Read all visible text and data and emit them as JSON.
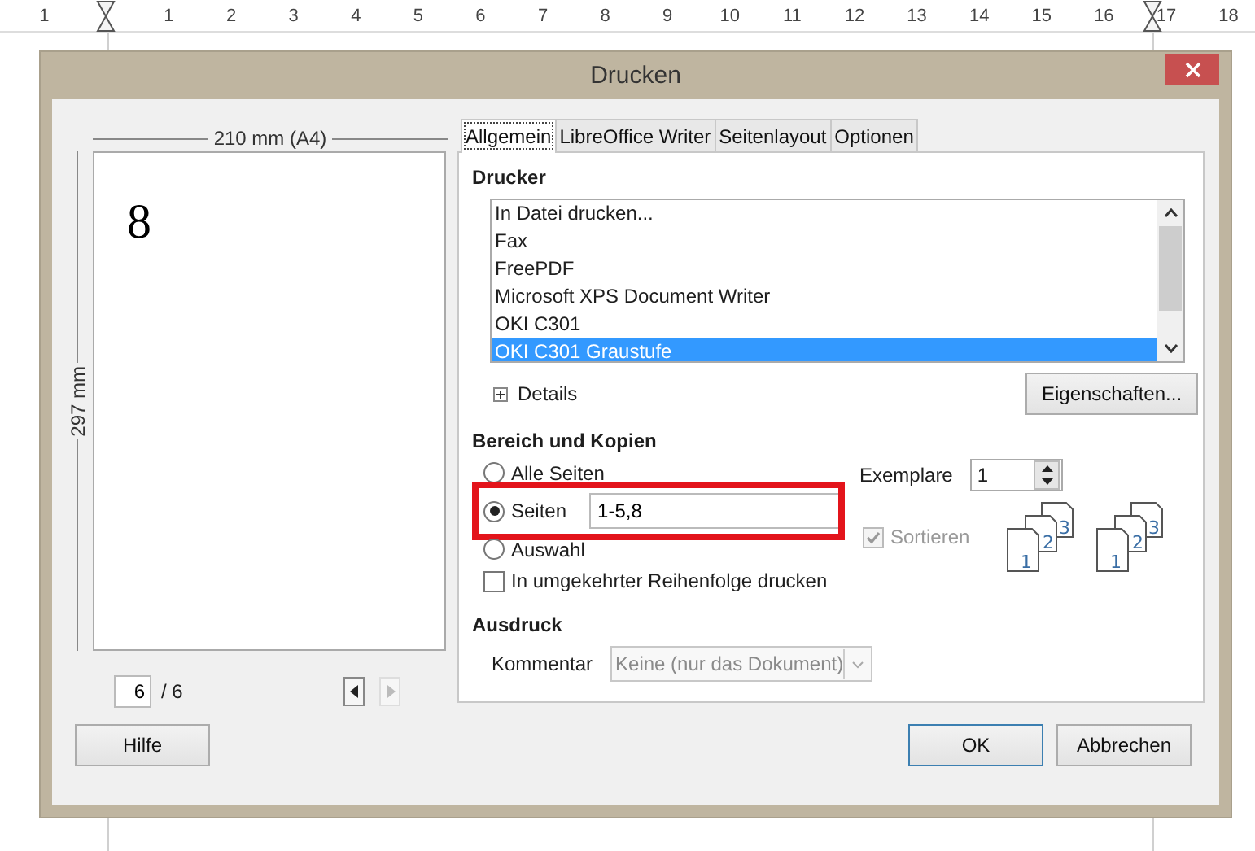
{
  "ruler": {
    "labels": [
      "1",
      "1",
      "2",
      "3",
      "4",
      "5",
      "6",
      "7",
      "8",
      "9",
      "10",
      "11",
      "12",
      "13",
      "14",
      "15",
      "16",
      "17",
      "18"
    ]
  },
  "window": {
    "title": "Drucken"
  },
  "preview": {
    "width_label": "210 mm (A4)",
    "height_label": "297 mm",
    "page_text": "8",
    "page_field": "6",
    "page_total": "/ 6",
    "prev_disabled": false,
    "next_disabled": true
  },
  "tabs": [
    {
      "label": "Allgemein",
      "selected": true
    },
    {
      "label": "LibreOffice Writer",
      "selected": false
    },
    {
      "label": "Seitenlayout",
      "selected": false
    },
    {
      "label": "Optionen",
      "selected": false
    }
  ],
  "printer": {
    "heading": "Drucker",
    "items": [
      {
        "label": "In Datei drucken...",
        "selected": false
      },
      {
        "label": "Fax",
        "selected": false
      },
      {
        "label": "FreePDF",
        "selected": false
      },
      {
        "label": "Microsoft XPS Document Writer",
        "selected": false
      },
      {
        "label": "OKI C301",
        "selected": false
      },
      {
        "label": "OKI C301 Graustufe",
        "selected": true
      }
    ],
    "details": {
      "label": "Details",
      "expanded": false
    },
    "properties_button": "Eigenschaften..."
  },
  "range": {
    "heading": "Bereich und Kopien",
    "options": [
      {
        "label": "Alle Seiten",
        "selected": false,
        "highlighted": false
      },
      {
        "label": "Seiten",
        "selected": true,
        "highlighted": true,
        "value": "1-5,8"
      },
      {
        "label": "Auswahl",
        "selected": false,
        "highlighted": false
      }
    ],
    "reverse": {
      "label": "In umgekehrter Reihenfolge drucken",
      "checked": false
    },
    "copies_label": "Exemplare",
    "copies": "1",
    "collate": {
      "label": "Sortieren",
      "checked": true,
      "disabled": true
    },
    "collate_icons": [
      {
        "labels": [
          "1",
          "2",
          "3"
        ]
      },
      {
        "labels": [
          "1",
          "2",
          "3"
        ]
      }
    ]
  },
  "output": {
    "heading": "Ausdruck",
    "comment_label": "Kommentar",
    "comment_value": "Keine (nur das Dokument)",
    "comment_disabled": true
  },
  "buttons": [
    {
      "label": "Hilfe",
      "default": false
    },
    {
      "label": "OK",
      "default": true
    },
    {
      "label": "Abbrechen",
      "default": false
    }
  ]
}
